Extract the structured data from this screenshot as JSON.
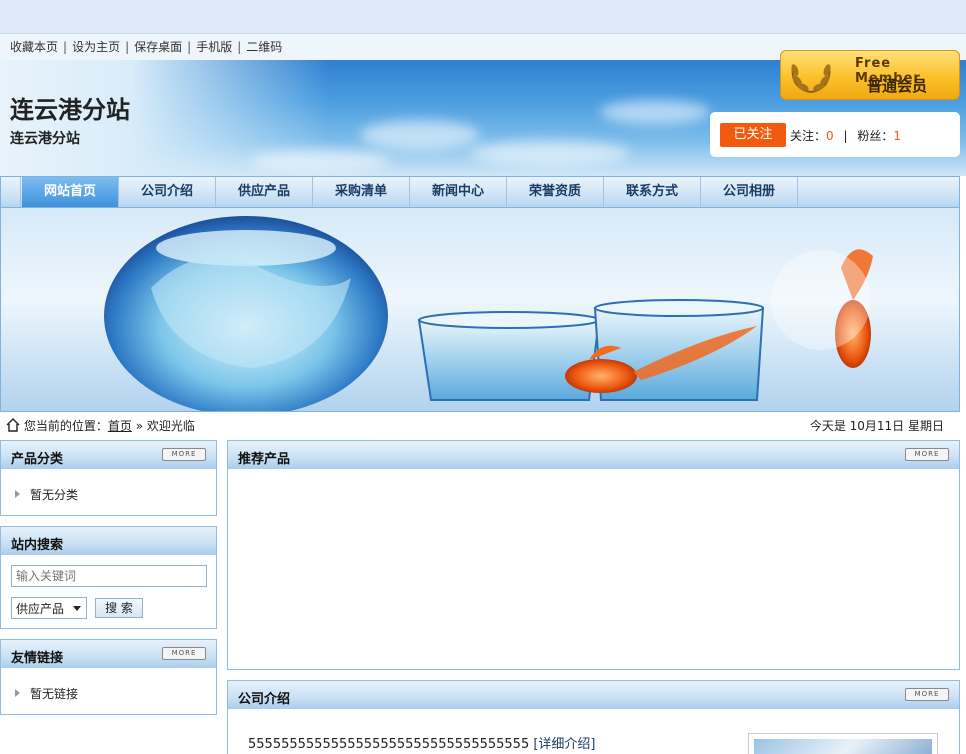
{
  "toplinks": [
    "收藏本页",
    "设为主页",
    "保存桌面",
    "手机版",
    "二维码"
  ],
  "site": {
    "title": "连云港分站",
    "subtitle": "连云港分站"
  },
  "member": {
    "free_label": "Free Member",
    "level_label": "普通会员"
  },
  "follow": {
    "button": "已关注",
    "follow_label": "关注：",
    "follow_count": "0",
    "sep": "|",
    "fans_label": "粉丝：",
    "fans_count": "1"
  },
  "nav": [
    "网站首页",
    "公司介绍",
    "供应产品",
    "采购清单",
    "新闻中心",
    "荣誉资质",
    "联系方式",
    "公司相册"
  ],
  "breadcrumb": {
    "prefix": "您当前的位置：",
    "home": "首页",
    "separator": "»",
    "current": "欢迎光临"
  },
  "date": "今天是  10月11日  星期日",
  "more_label": "MORE",
  "sidebar": {
    "categories": {
      "title": "产品分类",
      "empty": "暂无分类"
    },
    "search": {
      "title": "站内搜索",
      "placeholder": "输入关键词",
      "select_value": "供应产品",
      "button": "搜 索"
    },
    "links": {
      "title": "友情链接",
      "empty": "暂无链接"
    }
  },
  "main": {
    "recommended": {
      "title": "推荐产品"
    },
    "intro": {
      "title": "公司介绍",
      "text": "5555555555555555555555555555555555",
      "more": "[详细介绍]"
    }
  },
  "colors": {
    "accent": "#f25a0e",
    "nav_active": "#3f92dc",
    "border": "#8fbde3"
  }
}
